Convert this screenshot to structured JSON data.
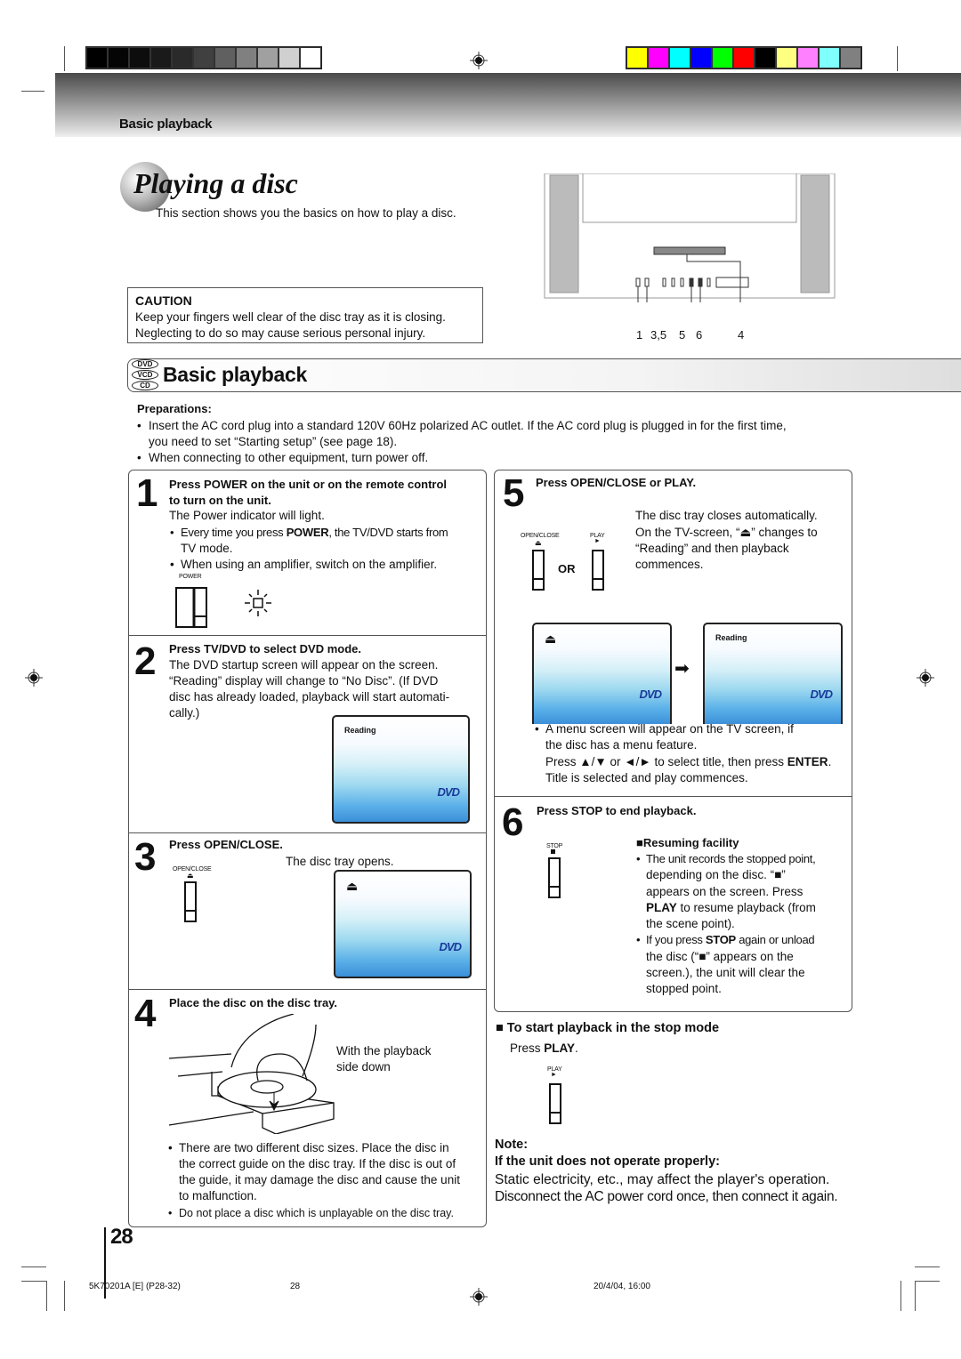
{
  "header": {
    "section_label": "Basic playback",
    "grayscale_swatches": [
      "#000000",
      "#050505",
      "#0d0d0d",
      "#1a1a1a",
      "#2a2a2a",
      "#404040",
      "#606060",
      "#808080",
      "#a0a0a0",
      "#d0d0d0",
      "#ffffff"
    ],
    "color_swatches": [
      "#ffff00",
      "#ff00ff",
      "#00ffff",
      "#0000ff",
      "#00ff00",
      "#ff0000",
      "#000000",
      "#ffff80",
      "#ff80ff",
      "#80ffff",
      "#808080"
    ]
  },
  "page": {
    "title": "Playing a disc",
    "intro": "This section shows you the basics on how to play a disc."
  },
  "caution": {
    "heading": "CAUTION",
    "line1": "Keep your fingers well clear of the disc tray as it is closing.",
    "line2": "Neglecting to do so may cause serious personal injury."
  },
  "tv_diagram": {
    "callouts": [
      "1",
      "3,5",
      "5",
      "6",
      "4"
    ]
  },
  "section": {
    "badges": [
      "DVD",
      "VCD",
      "CD"
    ],
    "title": "Basic playback"
  },
  "preparations": {
    "heading": "Preparations:",
    "items": [
      "Insert the AC cord plug into a standard 120V 60Hz polarized AC outlet. If the AC cord plug is plugged in for the first time,",
      "you need to set “Starting setup” (see page 18).",
      "When connecting to other equipment, turn power off."
    ]
  },
  "steps": {
    "s1": {
      "num": "1",
      "head1": "Press POWER on the unit or on the remote control",
      "head2": "to turn on the unit.",
      "line": "The Power indicator will light.",
      "b1a": "Every time you press ",
      "b1b": "POWER",
      "b1c": ", the TV/DVD starts from",
      "b1d": "TV mode.",
      "b2": "When using an amplifier, switch on the amplifier.",
      "button_label": "POWER"
    },
    "s2": {
      "num": "2",
      "head": "Press TV/DVD to select DVD mode.",
      "lines": [
        "The DVD startup screen will appear on the screen.",
        "“Reading” display will change to “No Disc”. (If DVD",
        "disc has already loaded, playback will start automati-",
        "cally.)"
      ],
      "screen_label": "Reading",
      "screen_logo": "DVD"
    },
    "s3": {
      "num": "3",
      "head": "Press OPEN/CLOSE.",
      "line": "The disc tray opens.",
      "button_label": "OPEN/CLOSE",
      "screen_label": "⏏",
      "screen_logo": "DVD"
    },
    "s4": {
      "num": "4",
      "head": "Place the disc on the disc tray.",
      "caption1": "With the playback",
      "caption2": "side down",
      "notes": [
        "There are two different disc sizes. Place the disc in",
        "the correct guide on the disc tray. If the disc is out of",
        "the guide, it may damage the disc and cause the unit",
        "to malfunction.",
        "Do not place a disc which is unplayable on the disc tray."
      ]
    },
    "s5": {
      "num": "5",
      "head": "Press OPEN/CLOSE or PLAY.",
      "lines": [
        "The disc tray closes automatically.",
        "On the TV-screen, “⏏” changes to",
        "“Reading” and then playback",
        "commences."
      ],
      "btn1_label": "OPEN/CLOSE",
      "btn2_label": "PLAY",
      "or": "OR",
      "screen1_label": "⏏",
      "screen2_label": "Reading",
      "screen_logo": "DVD",
      "menu_lines": [
        "A menu screen will appear on the TV screen, if",
        "the disc has a menu feature.",
        "Press ▲/▼ or ◄/► to select title, then press ",
        "ENTER",
        ".",
        "Title is selected and play commences."
      ]
    },
    "s6": {
      "num": "6",
      "head": "Press STOP to end playback.",
      "button_label": "STOP",
      "resume_head": "■Resuming facility",
      "r1": [
        "The unit records the stopped point,",
        "depending on the disc. “■”",
        "appears on the screen. Press",
        "PLAY",
        " to resume playback (from",
        "the scene point)."
      ],
      "r2": [
        "If you press ",
        "STOP",
        " again or unload",
        "the disc (“■” appears on the",
        "screen.), the unit will clear the",
        "stopped point."
      ]
    }
  },
  "stop_mode": {
    "heading": "■ To start playback in the stop mode",
    "press": "Press ",
    "press_bold": "PLAY",
    "press_end": ".",
    "button_label": "PLAY"
  },
  "note": {
    "heading": "Note:",
    "subheading": "If the unit does not operate properly:",
    "line1": "Static electricity, etc., may affect the player's operation.",
    "line2": "Disconnect the AC power cord once, then connect it again."
  },
  "footer": {
    "page_number": "28",
    "doc_code": "5K70201A [E] (P28-32)",
    "page_ref": "28",
    "datetime": "20/4/04, 16:00"
  }
}
